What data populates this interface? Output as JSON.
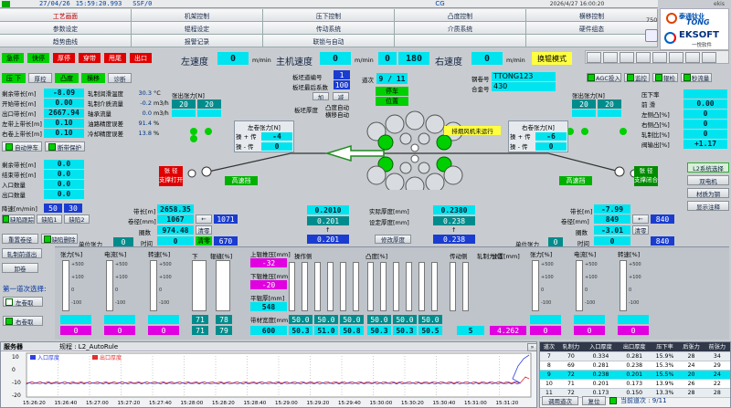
{
  "header": {
    "date": "27/04/26",
    "time": "15:59:20.993",
    "status": "SSF/0",
    "cg": "CG",
    "datetime2": "2026/4/27 16:00:20",
    "user": "ekis",
    "num": "750"
  },
  "logos": {
    "company1_cn": "泰通钛业",
    "company1_en": "TONG",
    "company2": "EKSOFT",
    "company2_cn": "一悦软件"
  },
  "nav": [
    [
      "工艺画面",
      "机架控制",
      "压下控制",
      "凸度控制",
      "横移控制"
    ],
    [
      "参数设定",
      "辊程设定",
      "传动系统",
      "介质系统",
      "硬件组态"
    ],
    [
      "趋势曲线",
      "报警记录",
      "联锁与自动",
      "",
      ""
    ]
  ],
  "mode_buttons": [
    "急停",
    "快停",
    "厚停",
    "穿带",
    "甩尾",
    "出口"
  ],
  "speeds": {
    "label1": "左速度",
    "val1": "0",
    "unit1": "m/min",
    "label2": "主机速度",
    "val2": "0",
    "unit2": "m/min",
    "mid_a": "0",
    "mid_b": "180",
    "label3": "右速度",
    "val3": "0",
    "unit3": "m/min",
    "change_roll": "换辊模式"
  },
  "row2_buttons": [
    "压 下",
    "厚控",
    "凸度",
    "横移",
    "诊断"
  ],
  "left_params": [
    [
      "剩余带长[m]",
      "-8.09"
    ],
    [
      "开始带长[m]",
      "0.00"
    ],
    [
      "出口带长[m]",
      "2667.94"
    ],
    [
      "左带上带长[m]",
      "0.10"
    ],
    [
      "右卷上带长[m]",
      "0.10"
    ]
  ],
  "roll_params": [
    [
      "轧制润滑温度",
      "30.3",
      "°C"
    ],
    [
      "轧制介质流量",
      "-0.2",
      "m3/h"
    ],
    [
      "轴承流量",
      "0.0",
      "m3/h"
    ],
    [
      "油路精度误差",
      "91.4",
      "%"
    ],
    [
      "冷却精度误差",
      "13.8",
      "%"
    ]
  ],
  "auto_stop": "自动停车",
  "break_protect": "断带保护",
  "left_params2": [
    [
      "剩余带长[m]",
      "0.0"
    ],
    [
      "结束带长[m]",
      "0.0"
    ],
    [
      "入口数量",
      "0.0"
    ],
    [
      "出口数量",
      "0.0"
    ]
  ],
  "left_speed": {
    "label": "降速[m/min]",
    "v1": "50",
    "v2": "30"
  },
  "left_btns": [
    "缺陷跟踪",
    "缺陷1",
    "缺陷2"
  ],
  "tension_left": {
    "title": "张出张力[N]",
    "a": "20",
    "b": "20"
  },
  "tension_right": {
    "title": "张出张力[N]",
    "a": "20",
    "b": "20"
  },
  "mid_panel": {
    "roll_no_label": "板坯道编号",
    "roll_no": "1",
    "pass_label": "板坯最后系数",
    "pass_val": "100",
    "pass_no_label": "道次",
    "pass_no": "9 / 11",
    "stop_label": "停车",
    "pos_label": "位置",
    "btn1": "加",
    "btn2": "减",
    "thick_label": "板坯厚度",
    "auto1": "凸度自动",
    "auto2": "横移自动"
  },
  "right_info": {
    "steel_label": "钢卷号",
    "steel_id": "TTONG123",
    "alloy_label": "合金号",
    "alloy": "430"
  },
  "right_btns": [
    "AGC投入",
    "监控",
    "辊检",
    "秒流量"
  ],
  "right_params": [
    [
      "压下率",
      ""
    ],
    [
      "前 滑",
      "0.00"
    ],
    [
      "左侧凸[%]",
      "0"
    ],
    [
      "右侧凸[%]",
      "0"
    ],
    [
      "轧制比[%]",
      "0"
    ],
    [
      "阀输出[%]",
      "+1.17"
    ]
  ],
  "left_coil_tension": {
    "title": "左卷张力[N]",
    "l1": "操 + 传",
    "v1": "-4",
    "l2": "操 - 传",
    "v2": "0"
  },
  "right_coil_tension": {
    "title": "右卷张力[N]",
    "l1": "操 + 传",
    "v1": "-6",
    "l2": "操 - 传",
    "v2": "0"
  },
  "fan_status": "排烟风机未运行",
  "high_speed": "高速挡",
  "left_coil_state": {
    "l1": "张 径",
    "l2": "支撑打开"
  },
  "right_coil_state": {
    "l1": "张 径",
    "l2": "支撑闭合"
  },
  "side_right_btns": [
    "L2系统选择",
    "双电机",
    "材质为钢",
    "显示注释"
  ],
  "left_strip": {
    "len_label": "带长[m]",
    "len": "2658.35",
    "coil_label": "卷径[mm]",
    "coil": "1067",
    "laps_label": "圈数",
    "laps": "974.48",
    "time_label": "时间",
    "time": "0",
    "tension_label": "单位张力",
    "tension": "0",
    "btn1": "清零",
    "btn2": "清零",
    "box1": "1071",
    "box2": "670"
  },
  "right_strip": {
    "len_label": "带长[m]",
    "len": "-7.99",
    "coil_label": "卷径[mm]",
    "coil": "849",
    "laps_label": "圈数",
    "laps": "-3.01",
    "time_label": "时间",
    "time": "0",
    "tension_label": "单位张力",
    "tension": "0",
    "btn1": "清零",
    "box1": "840",
    "box2": "840"
  },
  "thickness": {
    "actual_label": "实际厚度[mm]",
    "set_label": "设定厚度[mm]",
    "left_v1": "0.2010",
    "left_v2": "0.201",
    "left_v3": "0.201",
    "right_v1": "0.2380",
    "right_v2": "0.238",
    "right_v3": "0.238",
    "modify": "修改厚度"
  },
  "bottom_left_btns": [
    "重置卷径",
    "缺陷删除",
    "轧制前道出",
    "卸卷"
  ],
  "first_pass": {
    "title": "第一道次选择:",
    "left": "左卷取",
    "right": "右卷取"
  },
  "gauges": {
    "left": [
      "张力[%]",
      "电流[%]",
      "转速[%]"
    ],
    "right": [
      "张力[%]",
      "电流[%]",
      "转速[%]"
    ],
    "mid": [
      "下",
      "辊缝[%]"
    ],
    "scales": [
      "+500",
      "+100",
      "0",
      "-100"
    ]
  },
  "meas": {
    "a1": "71",
    "a2": "78",
    "b1": "71",
    "b2": "79",
    "up_label": "上辊推压[mm]",
    "up": "-32",
    "down_label": "下辊推压[mm]",
    "down": "-20",
    "level_label": "平辊厚[mm]",
    "level": "548",
    "width_label": "带材宽度[mm]",
    "width": "600"
  },
  "op_force": {
    "title": "操作侧",
    "vals1": [
      "50.0",
      "50.0",
      "50.0"
    ],
    "vals2": [
      "50.3",
      "51.0",
      "50.8"
    ]
  },
  "crown": {
    "title": "凸度[%]",
    "vals1": [
      "50.0",
      "50.0",
      "50.0"
    ],
    "vals2": [
      "50.3",
      "50.3",
      "50.5"
    ]
  },
  "drive": {
    "title": "传动侧"
  },
  "roll_force": {
    "title": "轧制力[t]",
    "val": "5"
  },
  "position": {
    "title": "位置[mm]",
    "val": "4.262"
  },
  "right_gauge_vals": {
    "a": "0",
    "b": "0",
    "c": "0",
    "d": "0"
  },
  "trend": {
    "server": "服务器",
    "title": "规程 : L2_AutoRule",
    "legend1": "入口厚度",
    "legend2": "出口厚度",
    "yticks": [
      "10",
      "0",
      "-10",
      "-20"
    ],
    "xticks": [
      "15:26:20",
      "15:26:40",
      "15:27:00",
      "15:27:20",
      "15:27:40",
      "15:28:00",
      "15:28:20",
      "15:28:40",
      "15:29:00",
      "15:29:20",
      "15:29:40",
      "15:30:00",
      "15:30:20",
      "15:30:40",
      "15:31:00",
      "15:31:20"
    ]
  },
  "pass_table": {
    "headers": [
      "道次",
      "轧制力",
      "入口厚度",
      "出口厚度",
      "压下率",
      "后张力",
      "前张力"
    ],
    "rows": [
      [
        "7",
        "70",
        "0.334",
        "0.281",
        "15.9%",
        "28",
        "34"
      ],
      [
        "8",
        "69",
        "0.281",
        "0.238",
        "15.3%",
        "24",
        "29"
      ],
      [
        "9",
        "72",
        "0.238",
        "0.201",
        "15.5%",
        "20",
        "24"
      ],
      [
        "10",
        "71",
        "0.201",
        "0.173",
        "13.9%",
        "26",
        "22"
      ],
      [
        "11",
        "72",
        "0.173",
        "0.150",
        "13.3%",
        "28",
        "28"
      ]
    ],
    "btn1": "调用道次",
    "btn2": "复位",
    "current": "当前道次 : 9/11"
  },
  "colors": {
    "cyan": "#00e4f0",
    "green": "#00d000",
    "red": "#e00000",
    "blue": "#1a3cd0",
    "magenta": "#e000e0",
    "teal": "#008c8c"
  }
}
